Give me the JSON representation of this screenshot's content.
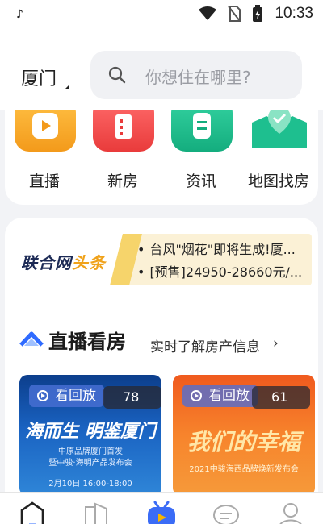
{
  "status_bar": {
    "time": "10:33"
  },
  "header": {
    "city": "厦门",
    "search_placeholder": "你想住在哪里?"
  },
  "menu": [
    {
      "label": "直播",
      "icon": "video-play-icon",
      "color": "#f6a525"
    },
    {
      "label": "新房",
      "icon": "building-icon",
      "color": "#ef4a4a"
    },
    {
      "label": "资讯",
      "icon": "news-icon",
      "color": "#1ebf8f"
    },
    {
      "label": "地图找房",
      "icon": "map-pin-icon",
      "color": "#1ebf8f"
    }
  ],
  "headlines": {
    "logo_main": "联合网",
    "logo_accent": "头条",
    "items": [
      "台风\"烟花\"即将生成!厦...",
      "[预售]24950-28660元/..."
    ]
  },
  "live": {
    "title": "直播看房",
    "subtitle": "实时了解房产信息",
    "chevron": "›",
    "cards": [
      {
        "badge": "看回放",
        "count": "78",
        "headline": "海而生 明鉴厦门",
        "line1": "中原品牌厦门首发",
        "line2": "暨中骏·海明产品发布会",
        "line3": "2月10日 16:00-18:00"
      },
      {
        "badge": "看回放",
        "count": "61",
        "headline": "我们的幸福",
        "line1": "2021中骏海西品牌焕新发布会"
      }
    ]
  },
  "tabbar": [
    {
      "name": "home",
      "icon": "home-icon"
    },
    {
      "name": "building",
      "icon": "building-outline-icon"
    },
    {
      "name": "live",
      "icon": "tv-play-icon"
    },
    {
      "name": "message",
      "icon": "chat-icon"
    },
    {
      "name": "profile",
      "icon": "user-icon"
    }
  ],
  "colors": {
    "accent": "#2f6bff",
    "headline_bg": "#fbf1d6"
  }
}
